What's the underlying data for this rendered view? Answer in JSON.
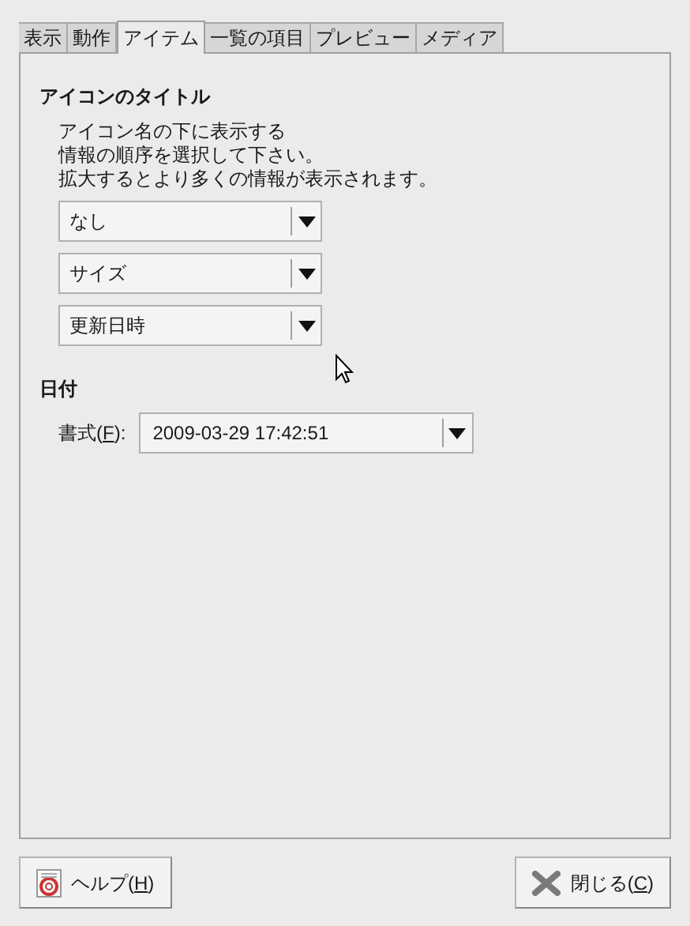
{
  "tabs": [
    {
      "label": "表示",
      "selected": false
    },
    {
      "label": "動作",
      "selected": false
    },
    {
      "label": "アイテム",
      "selected": true
    },
    {
      "label": "一覧の項目",
      "selected": false
    },
    {
      "label": "プレビュー",
      "selected": false
    },
    {
      "label": "メディア",
      "selected": false
    }
  ],
  "icon_captions": {
    "title": "アイコンのタイトル",
    "description": [
      "アイコン名の下に表示する",
      "情報の順序を選択して下さい。",
      "拡大するとより多くの情報が表示されます。"
    ],
    "dropdowns": [
      {
        "value": "なし"
      },
      {
        "value": "サイズ"
      },
      {
        "value": "更新日時"
      }
    ]
  },
  "date": {
    "title": "日付",
    "format_label": {
      "before": "書式(",
      "mnemonic": "F",
      "after": "):"
    },
    "format_value": "2009-03-29 17:42:51"
  },
  "buttons": [
    {
      "kind": "help",
      "before": "ヘルプ(",
      "mnemonic": "H",
      "after": ")"
    },
    {
      "kind": "close",
      "before": "閉じる(",
      "mnemonic": "C",
      "after": ")"
    }
  ]
}
